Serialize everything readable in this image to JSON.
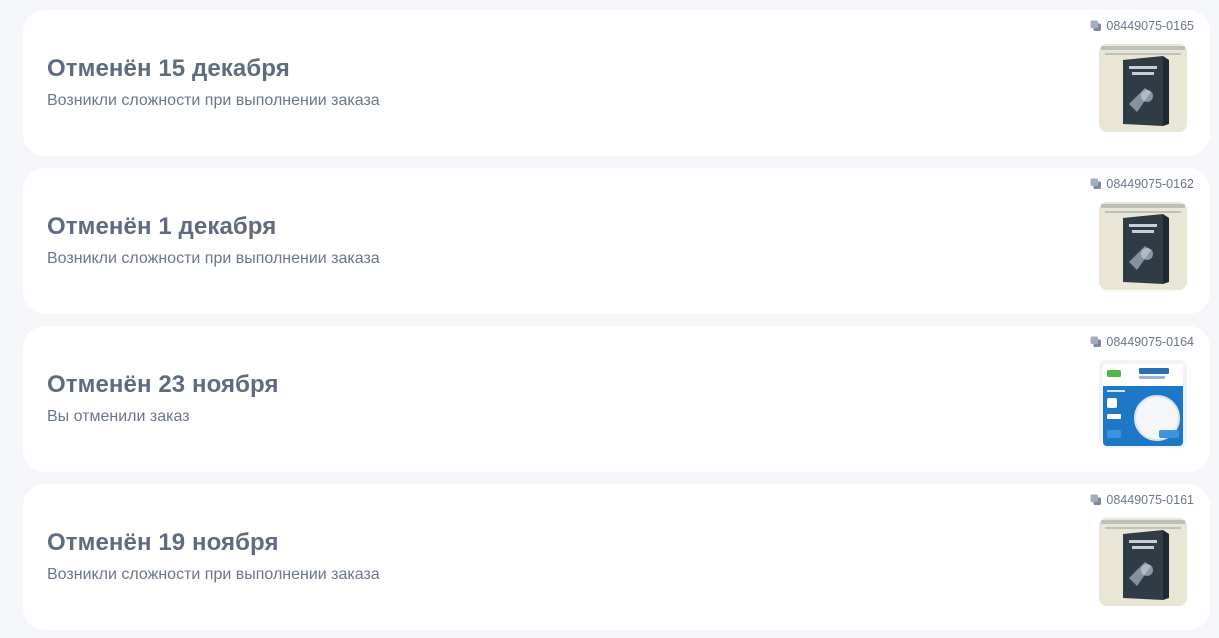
{
  "orders": [
    {
      "status": "Отменён 15 декабря",
      "reason": "Возникли сложности при выполнении заказа",
      "number": "08449075-0165",
      "product_icon": "book-cover"
    },
    {
      "status": "Отменён 1 декабря",
      "reason": "Возникли сложности при выполнении заказа",
      "number": "08449075-0162",
      "product_icon": "book-cover"
    },
    {
      "status": "Отменён 23 ноября",
      "reason": "Вы отменили заказ",
      "number": "08449075-0164",
      "product_icon": "lamp-box"
    },
    {
      "status": "Отменён 19 ноября",
      "reason": "Возникли сложности при выполнении заказа",
      "number": "08449075-0161",
      "product_icon": "book-cover"
    }
  ],
  "colors": {
    "background": "#f4f6fa",
    "card": "#ffffff",
    "title": "#5f6c7f",
    "text": "#6b7789"
  }
}
